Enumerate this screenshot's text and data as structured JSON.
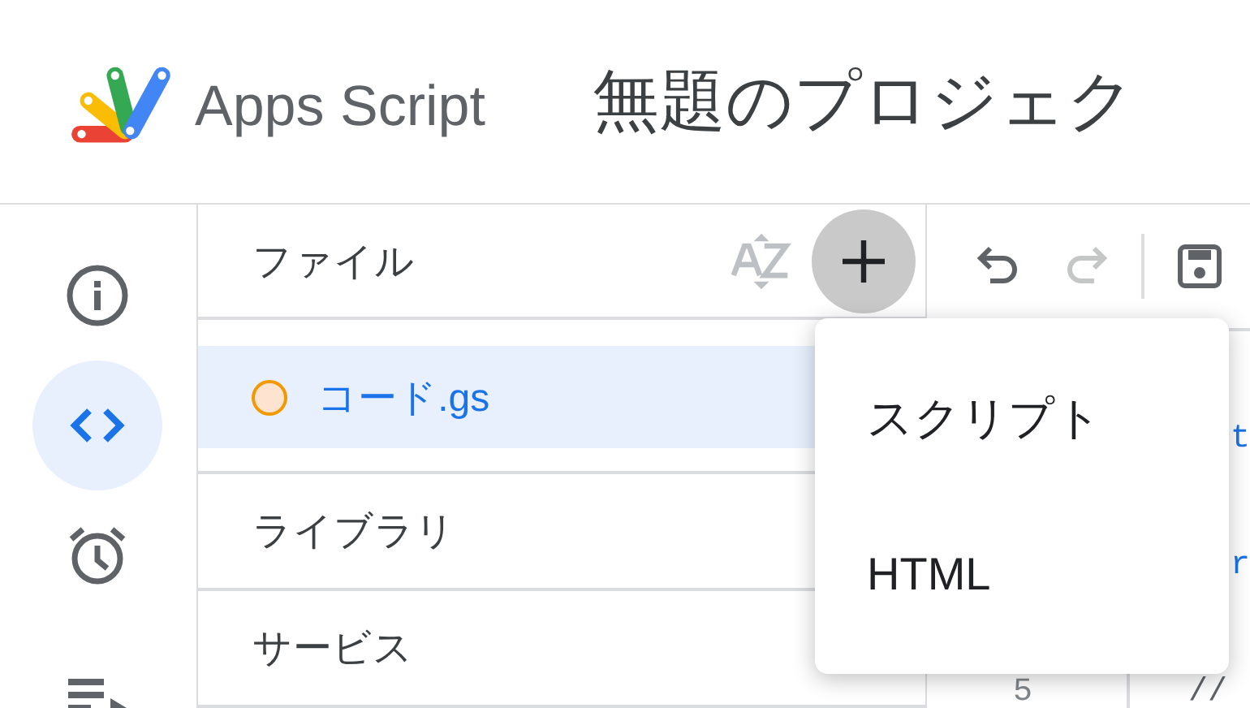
{
  "header": {
    "product": "Apps Script",
    "project_title": "無題のプロジェク"
  },
  "rail": [
    {
      "kind": "info",
      "selected": false
    },
    {
      "kind": "code",
      "selected": true
    },
    {
      "kind": "triggers",
      "selected": false
    },
    {
      "kind": "executions",
      "selected": false
    }
  ],
  "files_panel": {
    "title": "ファイル",
    "files": [
      {
        "name": "コード.gs",
        "selected": true
      }
    ],
    "sections": [
      "ライブラリ",
      "サービス"
    ]
  },
  "toolbar": [
    {
      "kind": "undo",
      "disabled": false
    },
    {
      "kind": "redo",
      "disabled": true
    },
    {
      "kind": "save",
      "disabled": false
    }
  ],
  "add_menu": {
    "items": [
      "スクリプト",
      "HTML"
    ]
  },
  "editor": {
    "lines": [
      {
        "code": "t",
        "color": "#1a73e8"
      },
      {
        "code": "r",
        "color": "#1a73e8"
      },
      {
        "number": "5",
        "code": "//",
        "color": "#5f6368"
      }
    ]
  }
}
